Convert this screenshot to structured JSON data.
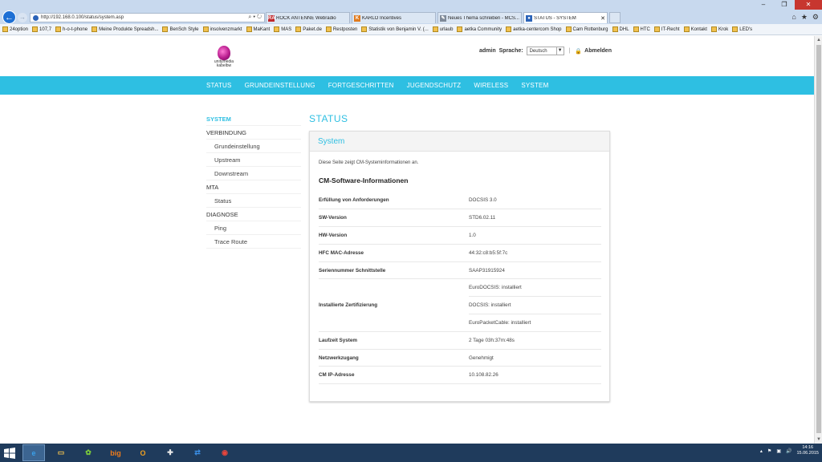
{
  "browser": {
    "url": "http://192.168.0.100/status/system.asp",
    "addr_tools": "⌕ ▾ ↻",
    "tabs": [
      {
        "label": "ROCK ANTENNE Webradio",
        "icon_text": "RA",
        "icon_color": "#c0282d"
      },
      {
        "label": "KARLO Incentives",
        "icon_text": "K",
        "icon_color": "#e07b1f"
      },
      {
        "label": "Neues Thema schreiben - MCS...",
        "icon_text": "✎",
        "icon_color": "#7f8a99"
      },
      {
        "label": "STATUS - SYSTEM",
        "icon_text": "●",
        "icon_color": "#2b63b8"
      }
    ],
    "right_icons": [
      "⌂",
      "★",
      "⚙"
    ],
    "window_controls": [
      "–",
      "❐",
      "✕"
    ],
    "bookmarks": [
      "24option",
      "107,7",
      "h-o-t-phone",
      "Meine Produkte Spreadsh...",
      "BenSch Style",
      "insolvenzmarkt",
      "MaKant",
      "MAS",
      "Paket.de",
      "Restposten",
      "Statistik von Benjamin V. (...",
      "urlaub",
      "aetka Community",
      "aetka-centercom Shop",
      "Cam Rottenburg",
      "DHL",
      "HTC",
      "IT-Recht",
      "Kontakt",
      "Krok",
      "LED's"
    ]
  },
  "header": {
    "logo_line1": "unitymedia",
    "logo_line2": "kabelbw",
    "user": "admin",
    "language_label": "Sprache:",
    "language_value": "Deutsch",
    "logout": "Abmelden"
  },
  "mainnav": [
    "STATUS",
    "GRUNDEINSTELLUNG",
    "FORTGESCHRITTEN",
    "JUGENDSCHUTZ",
    "WIRELESS",
    "SYSTEM"
  ],
  "sidebar": [
    {
      "label": "SYSTEM",
      "level": 0,
      "active": true
    },
    {
      "label": "VERBINDUNG",
      "level": 0
    },
    {
      "label": "Grundeinstellung",
      "level": 1
    },
    {
      "label": "Upstream",
      "level": 1
    },
    {
      "label": "Downstream",
      "level": 1
    },
    {
      "label": "MTA",
      "level": 0
    },
    {
      "label": "Status",
      "level": 1
    },
    {
      "label": "DIAGNOSE",
      "level": 0
    },
    {
      "label": "Ping",
      "level": 1
    },
    {
      "label": "Trace Route",
      "level": 1
    }
  ],
  "main": {
    "title": "STATUS",
    "panel_title": "System",
    "description": "Diese Seite zeigt CM-Systeminformationen an.",
    "subtitle": "CM-Software-Informationen",
    "rows": [
      {
        "key": "Erfüllung von Anforderungen",
        "values": [
          "DOCSIS 3.0"
        ]
      },
      {
        "key": "SW-Version",
        "values": [
          "STD6.02.11"
        ]
      },
      {
        "key": "HW-Version",
        "values": [
          "1.0"
        ]
      },
      {
        "key": "HFC MAC-Adresse",
        "values": [
          "44:32:c8:b5:5f:7c"
        ]
      },
      {
        "key": "Seriennummer Schnittstelle",
        "values": [
          "SAAP31915924"
        ]
      },
      {
        "key": "Installierte Zertifizierung",
        "values": [
          "EuroDOCSIS: installiert",
          "DOCSIS: installiert",
          "EuroPacketCable: installiert"
        ]
      },
      {
        "key": "Laufzeit System",
        "values": [
          "2 Tage 03h:37m:48s"
        ]
      },
      {
        "key": "Netzwerkzugang",
        "values": [
          "Genehmigt"
        ]
      },
      {
        "key": "CM IP-Adresse",
        "values": [
          "10.108.82.26"
        ]
      }
    ]
  },
  "taskbar": {
    "apps": [
      "ie-icon",
      "explorer-icon",
      "icq-icon",
      "big-icon",
      "outlook-icon",
      "puzzle-icon",
      "teamviewer-icon",
      "chrome-icon"
    ],
    "time": "14:16",
    "date": "15.06.2015"
  }
}
